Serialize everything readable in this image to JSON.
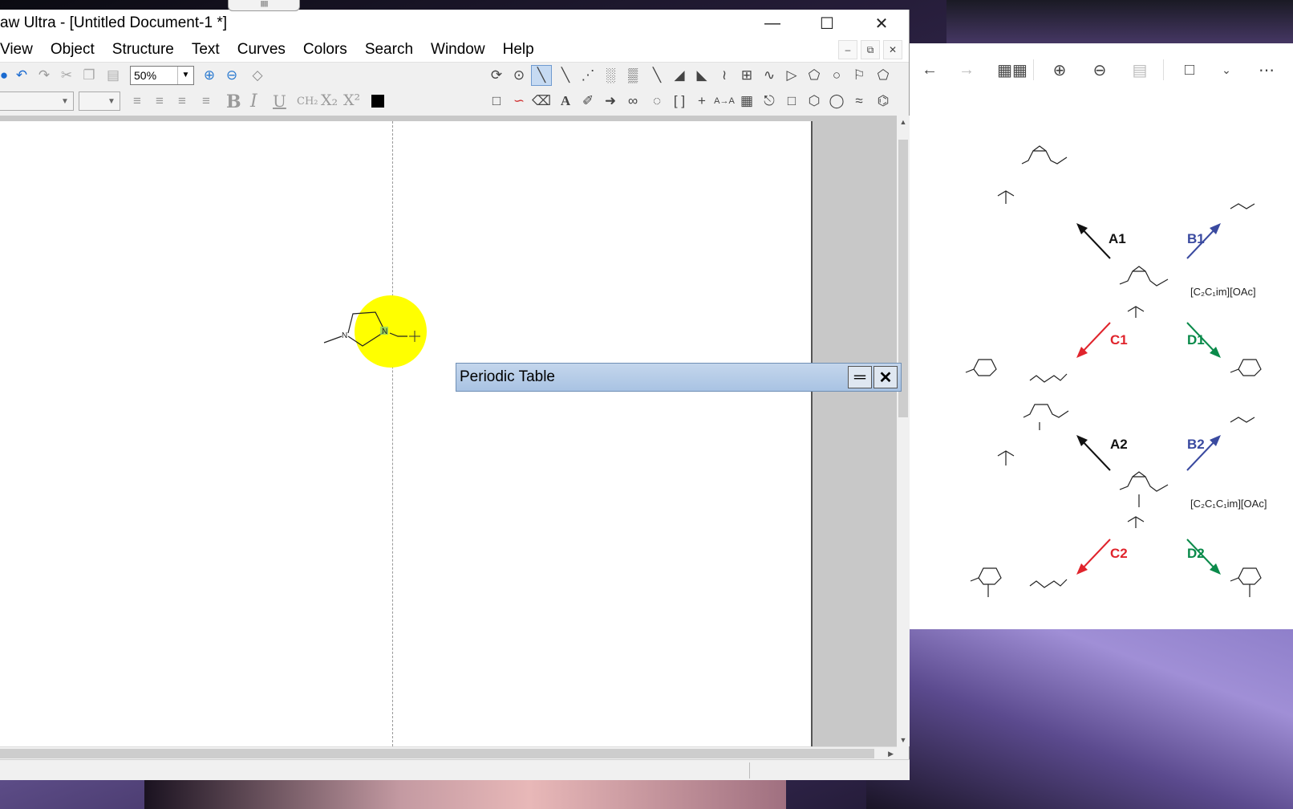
{
  "app": {
    "title": "aw Ultra - [Untitled Document-1 *]",
    "menu": [
      "View",
      "Object",
      "Structure",
      "Text",
      "Curves",
      "Colors",
      "Search",
      "Window",
      "Help"
    ],
    "zoom": "50%",
    "text_tools": {
      "bold": "B",
      "italic": "I",
      "underline": "U",
      "formula": "CH₂",
      "subscript": "X₂",
      "superscript": "X²"
    }
  },
  "canvas": {
    "molecule_atom_n1": "N",
    "molecule_atom_n2": "N"
  },
  "periodic_table": {
    "title": "Periodic Table"
  },
  "viewer": {
    "scheme": {
      "routes": [
        {
          "label": "A1",
          "color": "#111111"
        },
        {
          "label": "B1",
          "color": "#3a4aa0"
        },
        {
          "label": "C1",
          "color": "#e0242c"
        },
        {
          "label": "D1",
          "color": "#0a8a4a"
        },
        {
          "label": "A2",
          "color": "#111111"
        },
        {
          "label": "B2",
          "color": "#3a4aa0"
        },
        {
          "label": "C2",
          "color": "#e0242c"
        },
        {
          "label": "D2",
          "color": "#0a8a4a"
        }
      ],
      "salt1": "[C₂C₁im][OAc]",
      "salt2": "[C₂C₁C₁im][OAc]"
    }
  }
}
